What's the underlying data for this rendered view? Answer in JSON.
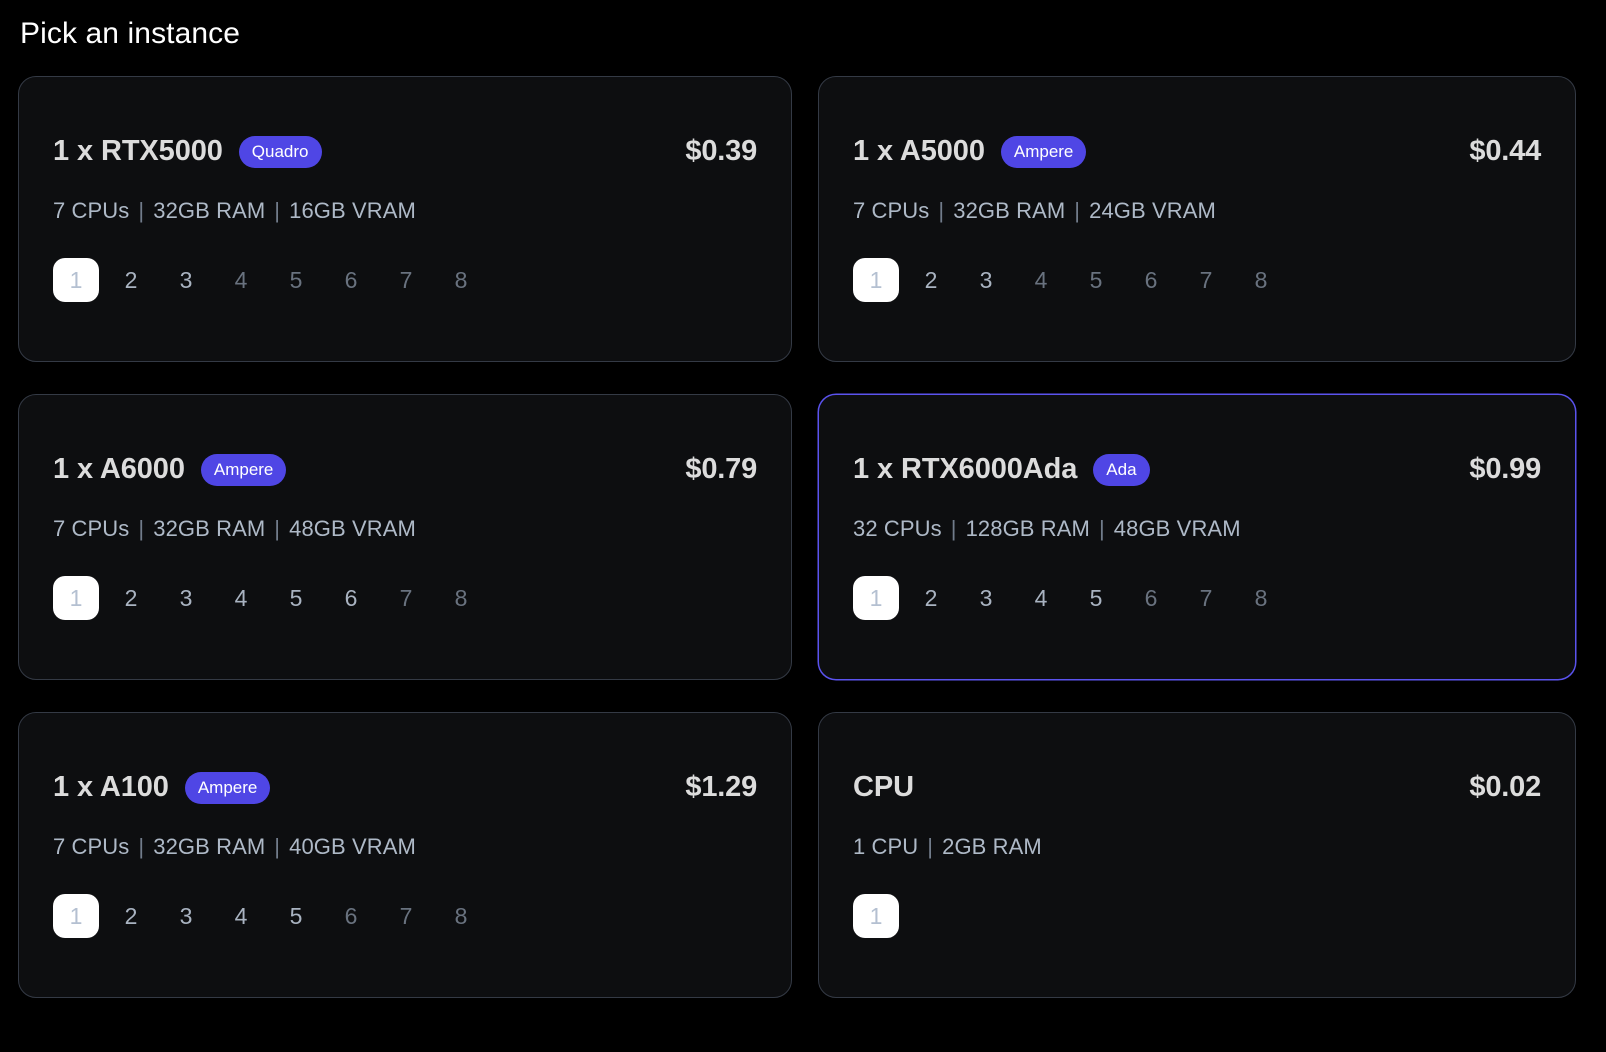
{
  "header": {
    "title": "Pick an instance"
  },
  "colors": {
    "page_background": "#000000",
    "card_background": "#0d0e10",
    "card_border": "#343a45",
    "selected_border": "#5b53ee",
    "badge_background": "#4f46e5",
    "title_text": "#dcdcdc",
    "spec_text": "#aeb9c7",
    "qty_enabled": "#a9b3c1",
    "qty_disabled": "#69727f",
    "qty_selected_bg": "#ffffff",
    "qty_selected_text": "#b4c0d1"
  },
  "separator": "|",
  "instances": [
    {
      "name": "1 x RTX5000",
      "badge": "Quadro",
      "price": "$0.39",
      "cpus": "7 CPUs",
      "ram": "32GB RAM",
      "vram": "16GB VRAM",
      "selected": false,
      "quantities": [
        {
          "label": "1",
          "state": "selected"
        },
        {
          "label": "2",
          "state": "enabled"
        },
        {
          "label": "3",
          "state": "enabled"
        },
        {
          "label": "4",
          "state": "disabled"
        },
        {
          "label": "5",
          "state": "disabled"
        },
        {
          "label": "6",
          "state": "disabled"
        },
        {
          "label": "7",
          "state": "disabled"
        },
        {
          "label": "8",
          "state": "disabled"
        }
      ]
    },
    {
      "name": "1 x A5000",
      "badge": "Ampere",
      "price": "$0.44",
      "cpus": "7 CPUs",
      "ram": "32GB RAM",
      "vram": "24GB VRAM",
      "selected": false,
      "quantities": [
        {
          "label": "1",
          "state": "selected"
        },
        {
          "label": "2",
          "state": "enabled"
        },
        {
          "label": "3",
          "state": "enabled"
        },
        {
          "label": "4",
          "state": "disabled"
        },
        {
          "label": "5",
          "state": "disabled"
        },
        {
          "label": "6",
          "state": "disabled"
        },
        {
          "label": "7",
          "state": "disabled"
        },
        {
          "label": "8",
          "state": "disabled"
        }
      ]
    },
    {
      "name": "1 x A6000",
      "badge": "Ampere",
      "price": "$0.79",
      "cpus": "7 CPUs",
      "ram": "32GB RAM",
      "vram": "48GB VRAM",
      "selected": false,
      "quantities": [
        {
          "label": "1",
          "state": "selected"
        },
        {
          "label": "2",
          "state": "enabled"
        },
        {
          "label": "3",
          "state": "enabled"
        },
        {
          "label": "4",
          "state": "enabled"
        },
        {
          "label": "5",
          "state": "enabled"
        },
        {
          "label": "6",
          "state": "enabled"
        },
        {
          "label": "7",
          "state": "disabled"
        },
        {
          "label": "8",
          "state": "disabled"
        }
      ]
    },
    {
      "name": "1 x RTX6000Ada",
      "badge": "Ada",
      "price": "$0.99",
      "cpus": "32 CPUs",
      "ram": "128GB RAM",
      "vram": "48GB VRAM",
      "selected": true,
      "quantities": [
        {
          "label": "1",
          "state": "selected"
        },
        {
          "label": "2",
          "state": "enabled"
        },
        {
          "label": "3",
          "state": "enabled"
        },
        {
          "label": "4",
          "state": "enabled"
        },
        {
          "label": "5",
          "state": "enabled"
        },
        {
          "label": "6",
          "state": "disabled"
        },
        {
          "label": "7",
          "state": "disabled"
        },
        {
          "label": "8",
          "state": "disabled"
        }
      ]
    },
    {
      "name": "1 x A100",
      "badge": "Ampere",
      "price": "$1.29",
      "cpus": "7 CPUs",
      "ram": "32GB RAM",
      "vram": "40GB VRAM",
      "selected": false,
      "quantities": [
        {
          "label": "1",
          "state": "selected"
        },
        {
          "label": "2",
          "state": "enabled"
        },
        {
          "label": "3",
          "state": "enabled"
        },
        {
          "label": "4",
          "state": "enabled"
        },
        {
          "label": "5",
          "state": "enabled"
        },
        {
          "label": "6",
          "state": "disabled"
        },
        {
          "label": "7",
          "state": "disabled"
        },
        {
          "label": "8",
          "state": "disabled"
        }
      ]
    },
    {
      "name": "CPU",
      "badge": "",
      "price": "$0.02",
      "cpus": "1 CPU",
      "ram": "2GB RAM",
      "vram": "",
      "selected": false,
      "quantities": [
        {
          "label": "1",
          "state": "selected"
        }
      ]
    }
  ]
}
